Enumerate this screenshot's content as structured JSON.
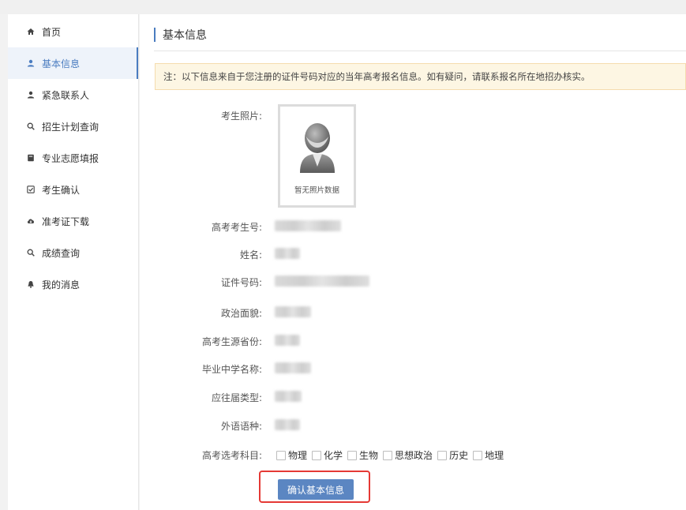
{
  "sidebar": {
    "items": [
      {
        "label": "首页",
        "icon": "home-icon",
        "active": false
      },
      {
        "label": "基本信息",
        "icon": "user-icon",
        "active": true
      },
      {
        "label": "紧急联系人",
        "icon": "user-icon",
        "active": false
      },
      {
        "label": "招生计划查询",
        "icon": "search-icon",
        "active": false
      },
      {
        "label": "专业志愿填报",
        "icon": "book-icon",
        "active": false
      },
      {
        "label": "考生确认",
        "icon": "checkbox-icon",
        "active": false
      },
      {
        "label": "准考证下载",
        "icon": "cloud-download-icon",
        "active": false
      },
      {
        "label": "成绩查询",
        "icon": "search-icon",
        "active": false
      },
      {
        "label": "我的消息",
        "icon": "bell-icon",
        "active": false
      }
    ]
  },
  "page": {
    "title": "基本信息",
    "notice": "注：以下信息来自于您注册的证件号码对应的当年高考报名信息。如有疑问，请联系报名所在地招办核实。"
  },
  "form": {
    "photo_label": "考生照片:",
    "photo_caption": "暂无照片数据",
    "fields": [
      {
        "label": "高考考生号:"
      },
      {
        "label": "姓名:"
      },
      {
        "label": "证件号码:"
      },
      {
        "label": "政治面貌:"
      },
      {
        "label": "高考生源省份:"
      },
      {
        "label": "毕业中学名称:"
      },
      {
        "label": "应往届类型:"
      },
      {
        "label": "外语语种:"
      }
    ],
    "subjects_label": "高考选考科目:",
    "subjects": [
      "物理",
      "化学",
      "生物",
      "思想政治",
      "历史",
      "地理"
    ]
  },
  "actions": {
    "confirm_label": "确认基本信息"
  },
  "colors": {
    "accent": "#4a7cc0",
    "button": "#5b86c2",
    "highlight_border": "#e53935",
    "notice_bg": "#fdf6e3"
  }
}
